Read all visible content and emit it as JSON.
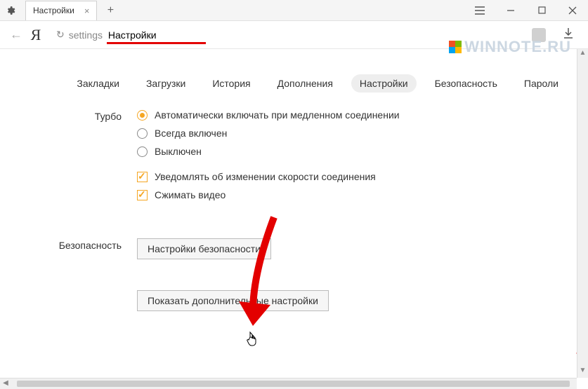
{
  "titlebar": {
    "tab_title": "Настройки",
    "close_symbol": "×",
    "newtab_symbol": "+"
  },
  "address": {
    "slug": "settings",
    "title": "Настройки"
  },
  "watermark": "WINNOTE.RU",
  "nav": {
    "items": [
      {
        "label": "Закладки"
      },
      {
        "label": "Загрузки"
      },
      {
        "label": "История"
      },
      {
        "label": "Дополнения"
      },
      {
        "label": "Настройки"
      },
      {
        "label": "Безопасность"
      },
      {
        "label": "Пароли"
      }
    ]
  },
  "sections": {
    "turbo": {
      "label": "Турбо",
      "radio": [
        "Автоматически включать при медленном соединении",
        "Всегда включен",
        "Выключен"
      ],
      "checks": [
        "Уведомлять об изменении скорости соединения",
        "Сжимать видео"
      ]
    },
    "security": {
      "label": "Безопасность",
      "button": "Настройки безопасности"
    },
    "advanced": {
      "button": "Показать дополнительные настройки"
    }
  }
}
